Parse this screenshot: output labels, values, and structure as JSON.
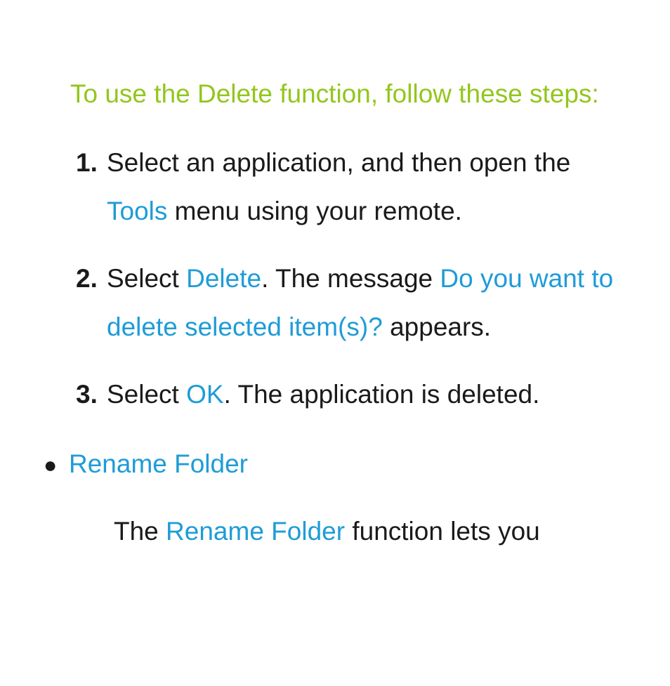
{
  "intro": "To use the Delete function, follow these steps:",
  "steps": [
    {
      "num": "1.",
      "parts": [
        {
          "t": "Select an application, and then open the "
        },
        {
          "t": "Tools",
          "cls": "blue"
        },
        {
          "t": " menu using your remote."
        }
      ]
    },
    {
      "num": "2.",
      "parts": [
        {
          "t": "Select "
        },
        {
          "t": "Delete",
          "cls": "blue"
        },
        {
          "t": ". The message "
        },
        {
          "t": "Do you want to delete selected item(s)?",
          "cls": "blue"
        },
        {
          "t": " appears."
        }
      ]
    },
    {
      "num": "3.",
      "parts": [
        {
          "t": "Select "
        },
        {
          "t": "OK",
          "cls": "blue"
        },
        {
          "t": ". The application is deleted."
        }
      ]
    }
  ],
  "bullet": {
    "label": "Rename Folder",
    "para_parts": [
      {
        "t": "The "
      },
      {
        "t": "Rename Folder",
        "cls": "blue"
      },
      {
        "t": " function lets you"
      }
    ]
  }
}
